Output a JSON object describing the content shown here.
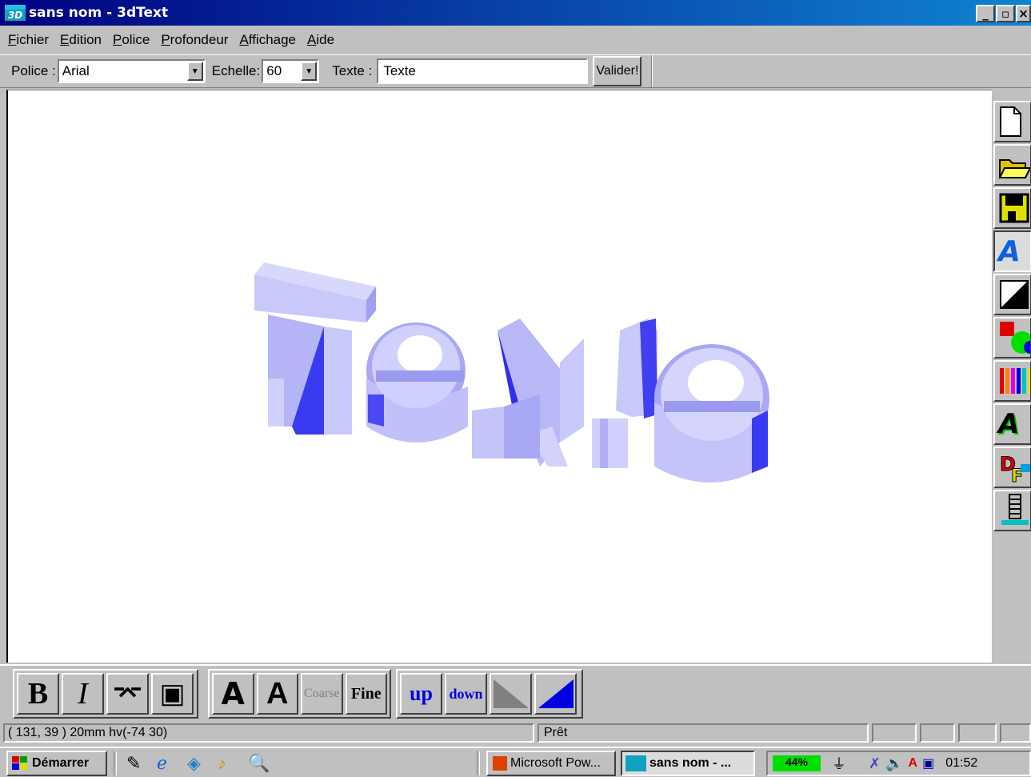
{
  "window": {
    "title": "sans nom - 3dText",
    "app_icon_text": "3D",
    "minimize_icon": "minimize-icon",
    "maximize_icon": "maximize-icon",
    "close_icon": "close-icon"
  },
  "menu": [
    "Fichier",
    "Edition",
    "Police",
    "Profondeur",
    "Affichage",
    "Aide"
  ],
  "toolbar": {
    "font_label": "Police :",
    "font_value": "Arial",
    "scale_label": "Echelle:",
    "scale_value": "60",
    "text_label": "Texte :",
    "text_value": "Texte",
    "validate_label": "Valider!"
  },
  "canvas": {
    "rendered_text": "Texte",
    "face_color": "#d4d4fc",
    "side_color": "#9a9af0",
    "shadow_color": "#3030f0"
  },
  "right_tools": [
    {
      "name": "new-document-icon",
      "glyph": "🗋"
    },
    {
      "name": "open-folder-icon",
      "glyph": "📂"
    },
    {
      "name": "save-icon",
      "glyph": "💾"
    },
    {
      "name": "text-style-icon",
      "glyph": "A"
    },
    {
      "name": "contrast-icon",
      "glyph": "◩"
    },
    {
      "name": "shapes-color-icon",
      "glyph": "●"
    },
    {
      "name": "color-bars-icon",
      "glyph": "|||"
    },
    {
      "name": "text-transform-icon",
      "glyph": "A"
    },
    {
      "name": "format-icon",
      "glyph": "DF"
    },
    {
      "name": "spiral-icon",
      "glyph": "§"
    }
  ],
  "bottom_tools": {
    "bold": "B",
    "italic": "I",
    "outline": "⌤",
    "frame": "▣",
    "font_a1": "A",
    "font_a2": "A",
    "coarse": "Coarse",
    "fine": "Fine",
    "up": "up",
    "down": "down"
  },
  "status": {
    "coords": "( 131, 39 ) 20mm  hv(-74 30)",
    "state": "Prêt"
  },
  "taskbar": {
    "start_label": "Démarrer",
    "task1": "Microsoft Pow...",
    "task2": "sans nom - ...",
    "battery": "44%",
    "clock": "01:52"
  }
}
